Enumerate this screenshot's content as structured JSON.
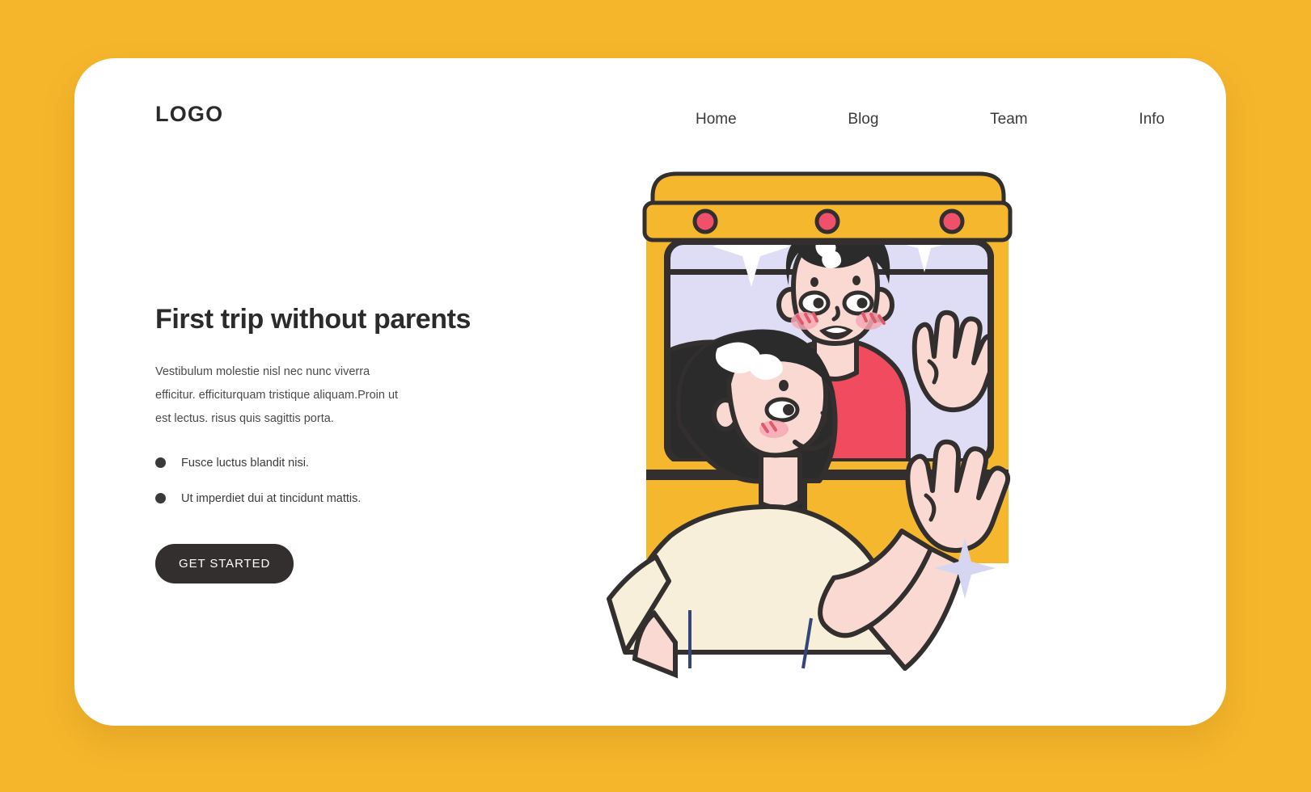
{
  "theme": {
    "background": "#F5B62C",
    "card": "#FFFFFF",
    "text_dark": "#2B2B2B",
    "button_bg": "#332F2E",
    "button_text": "#FFFFFF",
    "bus_yellow": "#F5B72E",
    "bus_outline": "#332F2E",
    "window_lavender": "#DEDDF5",
    "boy_shirt_red": "#F04B5E",
    "girl_shirt_cream": "#F7EFD9",
    "skin": "#FBD9D3",
    "hair_black": "#2B2B2B",
    "sparkle_white": "#FFFFFF",
    "sparkle_lavender": "#D7D6F2",
    "light_pink": "#F0606F"
  },
  "header": {
    "logo": "LOGO",
    "nav": [
      {
        "label": "Home"
      },
      {
        "label": "Blog"
      },
      {
        "label": "Team"
      },
      {
        "label": "Info"
      }
    ]
  },
  "hero": {
    "headline": "First trip without parents",
    "paragraph": "Vestibulum molestie nisl nec nunc viverra efficitur. efficiturquam tristique aliquam.Proin ut est lectus. risus quis sagittis porta.",
    "bullets": [
      {
        "text": "Fusce luctus blandit nisi."
      },
      {
        "text": "Ut imperdiet dui at tincidunt mattis."
      }
    ],
    "cta_label": "GET STARTED"
  },
  "illustration": {
    "name": "school-bus-children-waving",
    "description": "Two children waving from a yellow school bus window",
    "roof_lights": 3,
    "figures": [
      {
        "name": "boy",
        "hair": "black",
        "shirt": "red",
        "gesture": "waving"
      },
      {
        "name": "girl",
        "hair": "black-long",
        "shirt": "cream",
        "gesture": "waving"
      }
    ],
    "sparkles": 3
  }
}
